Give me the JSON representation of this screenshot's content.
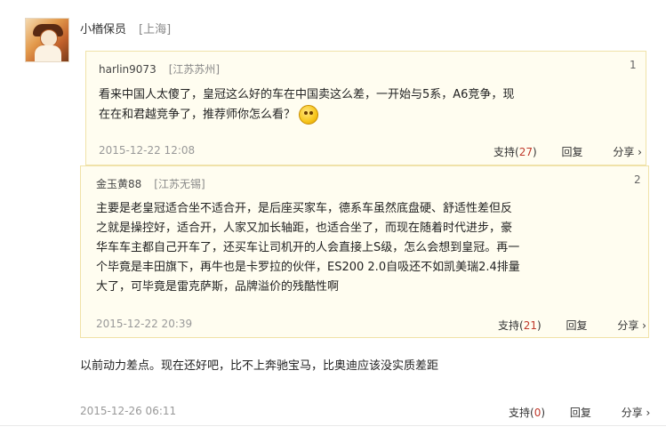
{
  "post": {
    "username": "小楢保员",
    "location": "[上海]"
  },
  "quotes": [
    {
      "user": "harlin9073",
      "location": "[江苏苏州]",
      "number": "1",
      "text_line1": "看来中国人太傻了，皇冠这么好的车在中国卖这么差，一开始与5系，A6竞争，现",
      "text_line2": "在在和君越竞争了，推荐师你怎么看？",
      "emoji": "smile-emoji-icon",
      "date": "2015-12-22 12:08",
      "support_label": "支持",
      "support_count": "27",
      "reply_label": "回复",
      "share_label": "分享 ›"
    },
    {
      "user": "金玉黄88",
      "location": "[江苏无锡]",
      "number": "2",
      "lines": [
        "主要是老皇冠适合坐不适合开，是后座买家车，德系车虽然底盘硬、舒适性差但反",
        "之就是操控好，适合开，人家又加长轴距，也适合坐了，而现在随着时代进步，豪",
        "华车车主都自己开车了，还买车让司机开的人会直接上S级，怎么会想到皇冠。再一",
        "个毕竟是丰田旗下，再牛也是卡罗拉的伙伴，ES200 2.0自吸还不如凯美瑞2.4排量",
        "大了，可毕竟是雷克萨斯，品牌溢价的残酷性啊"
      ],
      "date": "2015-12-22 20:39",
      "support_label": "支持",
      "support_count": "21",
      "reply_label": "回复",
      "share_label": "分享 ›"
    }
  ],
  "main": {
    "text": "以前动力差点。现在还好吧，比不上奔驰宝马，比奥迪应该没实质差距",
    "date": "2015-12-26 06:11",
    "support_label": "支持",
    "support_count": "0",
    "reply_label": "回复",
    "share_label": "分享 ›"
  }
}
